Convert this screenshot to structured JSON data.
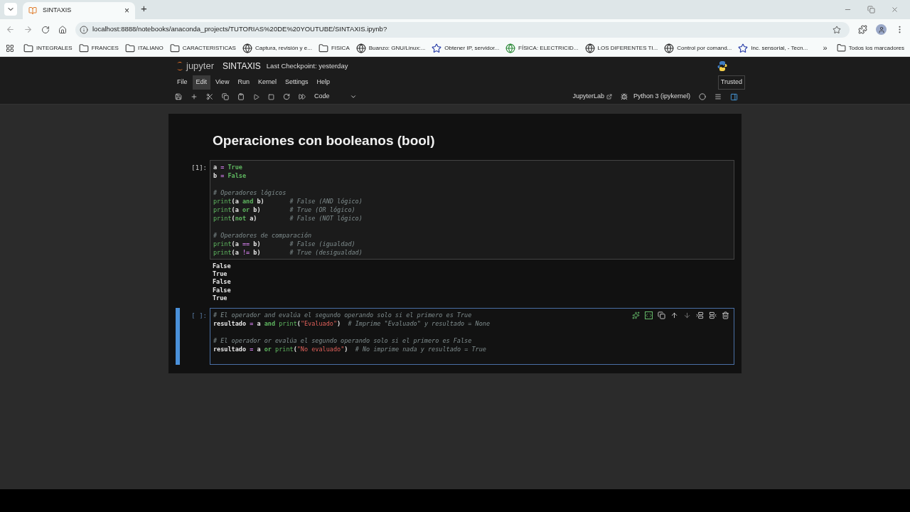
{
  "browser": {
    "tab": {
      "title": "SINTAXIS",
      "close": "×"
    },
    "new_tab": "+",
    "url": "localhost:8888/notebooks/anaconda_projects/TUTORIAS%20DE%20YOUTUBE/SINTAXIS.ipynb?",
    "bookmarks": [
      {
        "kind": "folder",
        "label": "INTEGRALES"
      },
      {
        "kind": "folder",
        "label": "FRANCES"
      },
      {
        "kind": "folder",
        "label": "ITALIANO"
      },
      {
        "kind": "folder",
        "label": "CARACTERISTICAS"
      },
      {
        "kind": "globe",
        "label": "Captura, revisión y e..."
      },
      {
        "kind": "folder",
        "label": "FISICA"
      },
      {
        "kind": "globe",
        "label": "Buanzo: GNU/Linux:..."
      },
      {
        "kind": "site",
        "label": "Obtener IP, servidor..."
      },
      {
        "kind": "earth",
        "label": "FÍSICA: ELECTRICID..."
      },
      {
        "kind": "globe",
        "label": "LOS DIFERENTES TI..."
      },
      {
        "kind": "globe",
        "label": "Control por comand..."
      },
      {
        "kind": "site",
        "label": "Inc. sensorial, - Tecn..."
      }
    ],
    "more": "»",
    "all_bookmarks": "Todos los marcadores"
  },
  "jupyter": {
    "logo": "jupyter",
    "notebook": "SINTAXIS",
    "checkpoint": "Last Checkpoint: yesterday",
    "menu": [
      {
        "label": "File",
        "selected": false
      },
      {
        "label": "Edit",
        "selected": true
      },
      {
        "label": "View",
        "selected": false
      },
      {
        "label": "Run",
        "selected": false
      },
      {
        "label": "Kernel",
        "selected": false
      },
      {
        "label": "Settings",
        "selected": false
      },
      {
        "label": "Help",
        "selected": false
      }
    ],
    "trusted": "Trusted",
    "cell_type": "Code",
    "lab_link": "JupyterLab",
    "kernel": "Python 3 (ipykernel)"
  },
  "heading": "Operaciones con booleanos (bool)",
  "cells": [
    {
      "prompt": "[1]:",
      "selected": false,
      "lines": [
        {
          "kind": "code",
          "tokens": [
            {
              "kind": "name",
              "text": "a"
            },
            {
              "kind": "op",
              "text": " = "
            },
            {
              "kind": "keyword",
              "text": "True"
            }
          ]
        },
        {
          "kind": "code",
          "tokens": [
            {
              "kind": "name",
              "text": "b"
            },
            {
              "kind": "op",
              "text": " = "
            },
            {
              "kind": "keyword",
              "text": "False"
            }
          ]
        },
        {
          "kind": "blank"
        },
        {
          "kind": "code",
          "tokens": [
            {
              "kind": "comment",
              "text": "# Operadores lógicos"
            }
          ]
        },
        {
          "kind": "code",
          "tokens": [
            {
              "kind": "builtin",
              "text": "print"
            },
            {
              "kind": "name",
              "text": "(a "
            },
            {
              "kind": "keyword",
              "text": "and"
            },
            {
              "kind": "name",
              "text": " b)       "
            },
            {
              "kind": "comment",
              "text": "# False (AND lógico)"
            }
          ]
        },
        {
          "kind": "code",
          "tokens": [
            {
              "kind": "builtin",
              "text": "print"
            },
            {
              "kind": "name",
              "text": "(a "
            },
            {
              "kind": "keyword",
              "text": "or"
            },
            {
              "kind": "name",
              "text": " b)        "
            },
            {
              "kind": "comment",
              "text": "# True (OR lógico)"
            }
          ]
        },
        {
          "kind": "code",
          "tokens": [
            {
              "kind": "builtin",
              "text": "print"
            },
            {
              "kind": "name",
              "text": "("
            },
            {
              "kind": "keyword",
              "text": "not"
            },
            {
              "kind": "name",
              "text": " a)         "
            },
            {
              "kind": "comment",
              "text": "# False (NOT lógico)"
            }
          ]
        },
        {
          "kind": "blank"
        },
        {
          "kind": "code",
          "tokens": [
            {
              "kind": "comment",
              "text": "# Operadores de comparación"
            }
          ]
        },
        {
          "kind": "code",
          "tokens": [
            {
              "kind": "builtin",
              "text": "print"
            },
            {
              "kind": "name",
              "text": "(a "
            },
            {
              "kind": "op",
              "text": "=="
            },
            {
              "kind": "name",
              "text": " b)        "
            },
            {
              "kind": "comment",
              "text": "# False (igualdad)"
            }
          ]
        },
        {
          "kind": "code",
          "tokens": [
            {
              "kind": "builtin",
              "text": "print"
            },
            {
              "kind": "name",
              "text": "(a "
            },
            {
              "kind": "op",
              "text": "!="
            },
            {
              "kind": "name",
              "text": " b)        "
            },
            {
              "kind": "comment",
              "text": "# True (desigualdad)"
            }
          ]
        }
      ],
      "output": [
        "False",
        "True",
        "False",
        "False",
        "True"
      ]
    },
    {
      "prompt": "[ ]:",
      "selected": true,
      "lines": [
        {
          "kind": "code",
          "tokens": [
            {
              "kind": "comment",
              "text": "# El operador and evalúa el segundo operando solo si el primero es True"
            }
          ]
        },
        {
          "kind": "code",
          "tokens": [
            {
              "kind": "name",
              "text": "resultado"
            },
            {
              "kind": "op",
              "text": " = "
            },
            {
              "kind": "name",
              "text": "a "
            },
            {
              "kind": "keyword",
              "text": "and "
            },
            {
              "kind": "builtin",
              "text": "print"
            },
            {
              "kind": "name",
              "text": "("
            },
            {
              "kind": "string",
              "text": "\"Evaluado\""
            },
            {
              "kind": "name",
              "text": ")  "
            },
            {
              "kind": "comment",
              "text": "# Imprime \"Evaluado\" y resultado = None"
            }
          ]
        },
        {
          "kind": "blank"
        },
        {
          "kind": "code",
          "tokens": [
            {
              "kind": "comment",
              "text": "# El operador or evalúa el segundo operando solo si el primero es False"
            }
          ]
        },
        {
          "kind": "code",
          "tokens": [
            {
              "kind": "name",
              "text": "resultado"
            },
            {
              "kind": "op",
              "text": " = "
            },
            {
              "kind": "name",
              "text": "a "
            },
            {
              "kind": "keyword",
              "text": "or "
            },
            {
              "kind": "builtin",
              "text": "print"
            },
            {
              "kind": "name",
              "text": "("
            },
            {
              "kind": "string",
              "text": "\"No evaluado\""
            },
            {
              "kind": "name",
              "text": ")  "
            },
            {
              "kind": "comment",
              "text": "# No imprime nada y resultado = True"
            }
          ]
        },
        {
          "kind": "blank"
        }
      ]
    }
  ]
}
